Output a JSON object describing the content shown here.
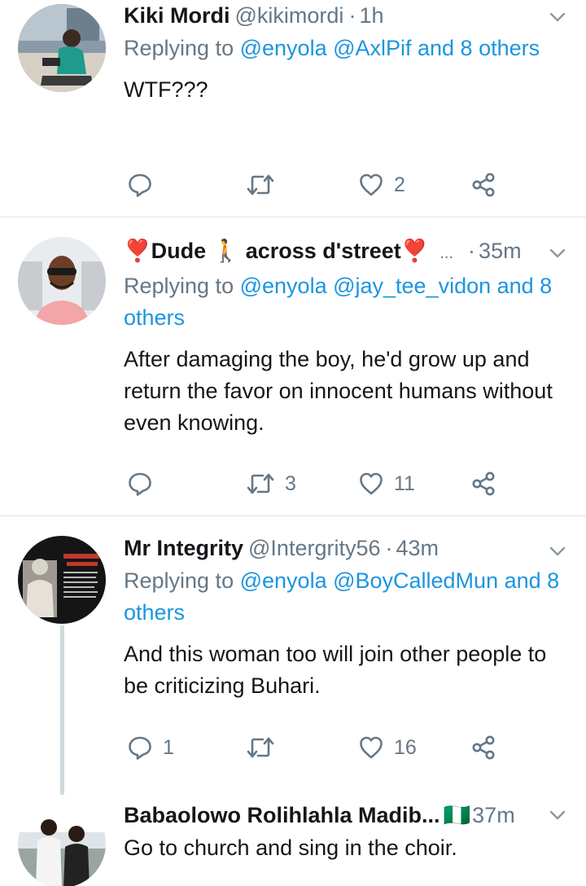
{
  "tweets": [
    {
      "name": "Kiki Mordi",
      "handle": "@kikimordi",
      "time": "1h",
      "reply_prefix": "Replying to",
      "reply_mentions": "@enyola @AxlPif and 8 others",
      "text": "WTF???",
      "reply_count": "",
      "retweet_count": "",
      "like_count": "2"
    },
    {
      "name": "❣️Dude 🚶 across d'street❣️",
      "ellipsis": "...",
      "handle": "",
      "time": "35m",
      "reply_prefix": "Replying to",
      "reply_mentions": "@enyola @jay_tee_vidon and 8 others",
      "text": "After damaging the boy, he'd grow up and return the favor on innocent humans without even knowing.",
      "reply_count": "",
      "retweet_count": "3",
      "like_count": "11"
    },
    {
      "name": "Mr Integrity",
      "handle": "@Intergrity56",
      "time": "43m",
      "reply_prefix": "Replying to",
      "reply_mentions": "@enyola @BoyCalledMun and 8 others",
      "text": "And this woman too will join other people to be criticizing Buhari.",
      "reply_count": "1",
      "retweet_count": "",
      "like_count": "16"
    },
    {
      "name": "Babaolowo Rolihlahla Madib...",
      "flag": "🇳🇬",
      "handle": "",
      "time": "37m",
      "text": "Go to church and sing in the choir."
    }
  ],
  "colors": {
    "text": "#14171a",
    "secondary": "#657786",
    "link": "#1b95e0",
    "divider": "#dfe3e6",
    "thread_line": "#cfd9de"
  },
  "icons": {
    "reply": "reply-icon",
    "retweet": "retweet-icon",
    "like": "heart-icon",
    "share": "share-icon",
    "menu": "chevron-down-icon"
  }
}
